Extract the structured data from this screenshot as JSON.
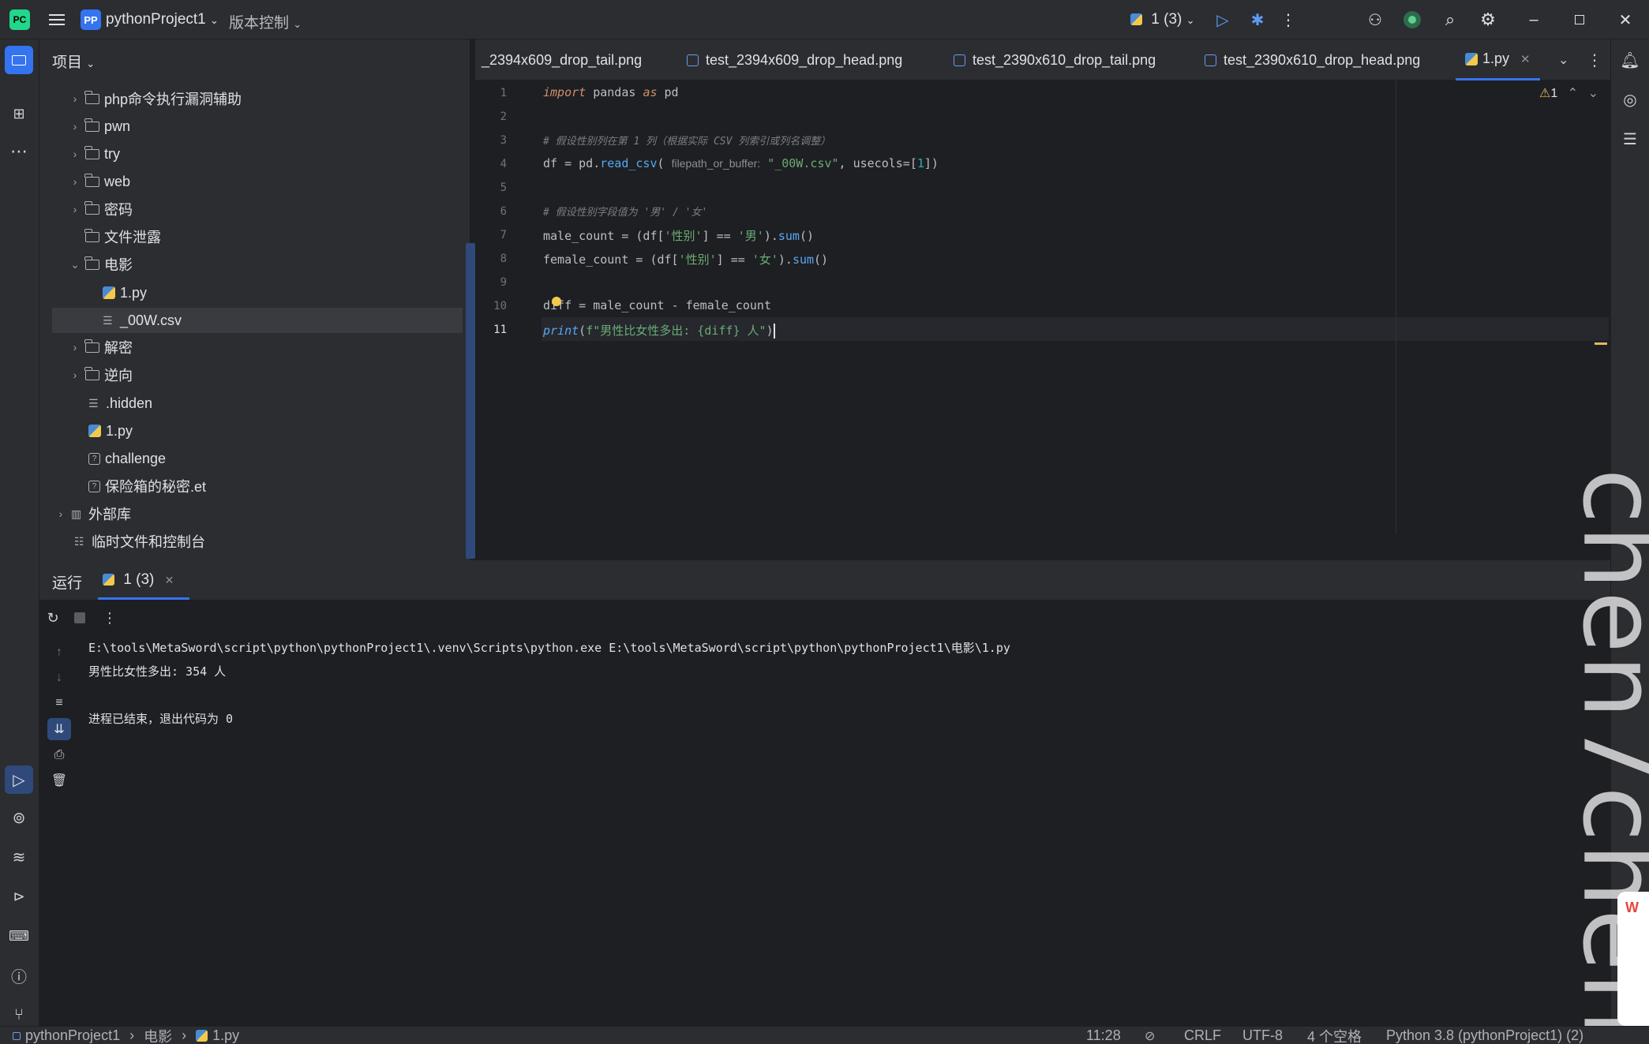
{
  "titlebar": {
    "project_badge": "PP",
    "project_name": "pythonProject1",
    "vcs_menu": "版本控制",
    "run_config": "1 (3)"
  },
  "project_panel": {
    "title": "项目",
    "items": [
      {
        "label": "php命令执行漏洞辅助",
        "type": "folder",
        "state": "collapsed"
      },
      {
        "label": "pwn",
        "type": "folder",
        "state": "collapsed"
      },
      {
        "label": "try",
        "type": "folder",
        "state": "collapsed"
      },
      {
        "label": "web",
        "type": "folder",
        "state": "collapsed"
      },
      {
        "label": "密码",
        "type": "folder",
        "state": "collapsed"
      },
      {
        "label": "文件泄露",
        "type": "folder",
        "state": "leaf"
      },
      {
        "label": "电影",
        "type": "folder",
        "state": "expanded"
      },
      {
        "label": "1.py",
        "type": "python"
      },
      {
        "label": "_00W.csv",
        "type": "text",
        "selected": true
      },
      {
        "label": "解密",
        "type": "folder",
        "state": "collapsed"
      },
      {
        "label": "逆向",
        "type": "folder",
        "state": "collapsed"
      },
      {
        "label": ".hidden",
        "type": "text"
      },
      {
        "label": "1.py",
        "type": "python"
      },
      {
        "label": "challenge",
        "type": "unknown"
      },
      {
        "label": "保险箱的秘密.et",
        "type": "unknown"
      },
      {
        "label": "外部库",
        "type": "library",
        "state": "collapsed"
      },
      {
        "label": "临时文件和控制台",
        "type": "scratch"
      }
    ]
  },
  "tabs": [
    {
      "label": "_2394x609_drop_tail.png",
      "type": "image"
    },
    {
      "label": "test_2394x609_drop_head.png",
      "type": "image"
    },
    {
      "label": "test_2390x610_drop_tail.png",
      "type": "image"
    },
    {
      "label": "test_2390x610_drop_head.png",
      "type": "image"
    },
    {
      "label": "1.py",
      "type": "python",
      "active": true
    }
  ],
  "editor": {
    "warning_count": "1",
    "line_numbers": [
      "1",
      "2",
      "3",
      "4",
      "5",
      "6",
      "7",
      "8",
      "9",
      "10",
      "11"
    ],
    "current_line": "11",
    "code": {
      "l1_kw_import": "import",
      "l1_mod": " pandas ",
      "l1_kw_as": "as",
      "l1_alias": " pd",
      "l3_comment": "# 假设性别列在第 1 列（根据实际 CSV 列索引或列名调整）",
      "l4_a": "df = pd.",
      "l4_fn": "read_csv",
      "l4_b": "( ",
      "l4_hint": "filepath_or_buffer:",
      "l4_c": " ",
      "l4_str": "\"_00W.csv\"",
      "l4_d": ", usecols=[",
      "l4_num": "1",
      "l4_e": "])",
      "l6_comment": "# 假设性别字段值为 '男' / '女'",
      "l7_a": "male_count = (df[",
      "l7_s1": "'性别'",
      "l7_b": "] == ",
      "l7_s2": "'男'",
      "l7_c": ").",
      "l7_fn": "sum",
      "l7_d": "()",
      "l8_a": "female_count = (df[",
      "l8_s1": "'性别'",
      "l8_b": "] == ",
      "l8_s2": "'女'",
      "l8_c": ").",
      "l8_fn": "sum",
      "l8_d": "()",
      "l10": "diff = male_count - female_count",
      "l11_fn": "print",
      "l11_a": "(",
      "l11_str": "f\"男性比女性多出: {diff} 人\"",
      "l11_b": ")"
    }
  },
  "run_panel": {
    "title": "运行",
    "tab_label": "1 (3)",
    "output": [
      "E:\\tools\\MetaSword\\script\\python\\pythonProject1\\.venv\\Scripts\\python.exe E:\\tools\\MetaSword\\script\\python\\pythonProject1\\电影\\1.py",
      "男性比女性多出: 354 人",
      "",
      "进程已结束，退出代码为 0"
    ]
  },
  "statusbar": {
    "breadcrumb": [
      "pythonProject1",
      "电影",
      "1.py"
    ],
    "position": "11:28",
    "line_sep": "CRLF",
    "encoding": "UTF-8",
    "indent": "4 个空格",
    "interpreter": "Python 3.8 (pythonProject1) (2)"
  },
  "watermark": "chen7chen",
  "colors": {
    "accent": "#3574f0",
    "background": "#1e1f22",
    "panel": "#2b2d30"
  }
}
